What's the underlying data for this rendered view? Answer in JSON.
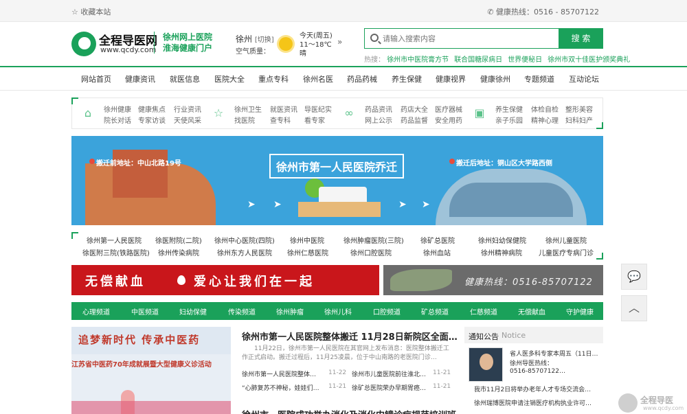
{
  "topbar": {
    "favorite": "收藏本站",
    "hotline": "健康热线：0516 - 85707122"
  },
  "logo": {
    "name": "全程导医网",
    "url": "www.qcdy.com"
  },
  "slogan": {
    "line1": "徐州网上医院",
    "line2": "淮海健康门户"
  },
  "weather": {
    "city": "徐州",
    "switch": "[切换]",
    "air": "空气质量：",
    "day": "今天(周五)",
    "temp": "11～18℃",
    "cond": "晴"
  },
  "search": {
    "placeholder": "请输入搜索内容",
    "button": "搜 索"
  },
  "hot": {
    "label": "热搜：",
    "items": [
      "徐州市中医院膏方节",
      "联合国糖尿病日",
      "世界便秘日",
      "徐州市双十佳医护颁奖典礼"
    ]
  },
  "nav": [
    "网站首页",
    "健康资讯",
    "就医信息",
    "医院大全",
    "重点专科",
    "徐州名医",
    "药品药械",
    "养生保健",
    "健康视界",
    "健康徐州",
    "专题频道",
    "互动论坛"
  ],
  "quick": {
    "g1": [
      "徐州健康",
      "健康焦点",
      "行业资讯",
      "院长对话",
      "专家访谈",
      "天使风采"
    ],
    "g2": [
      "徐州卫生",
      "就医资讯",
      "导医纪实",
      "找医院",
      "查专科",
      "看专家"
    ],
    "g3": [
      "药品资讯",
      "药店大全",
      "医疗器械",
      "网上公示",
      "药品监督",
      "安全用药"
    ],
    "g4": [
      "养生保健",
      "体检自检",
      "整形美容",
      "亲子乐园",
      "精神心理",
      "妇科妇产"
    ]
  },
  "banner": {
    "title": "徐州市第一人民医院乔迁",
    "old": "搬迁前地址：中山北路19号",
    "new": "搬迁后地址：铜山区大学路西侧"
  },
  "hospitals": {
    "row1": [
      "徐州第一人民医院",
      "徐医附院(二院)",
      "徐州中心医院(四院)",
      "徐州中医院",
      "徐州肿瘤医院(三院)",
      "徐矿总医院",
      "徐州妇幼保健院",
      "徐州儿童医院"
    ],
    "row2": [
      "徐医附三院(铁路医院)",
      "徐州传染病院",
      "徐州东方人民医院",
      "徐州仁慈医院",
      "徐州口腔医院",
      "徐州血站",
      "徐州精神病院",
      "儿童医疗专病门诊"
    ]
  },
  "ads": {
    "red1": "无偿献血",
    "red2": "爱心让我们在一起",
    "hotline": "健康热线：0516-85707122"
  },
  "channels": [
    "心理频道",
    "中医频道",
    "妇幼保健",
    "传染频道",
    "徐州肿瘤",
    "徐州儿科",
    "口腔频道",
    "矿总频道",
    "仁慈频道",
    "无偿献血",
    "守护健康"
  ],
  "photo": {
    "line1": "追梦新时代  传承中医药",
    "line2": "江苏省中医药70年成就展暨大型健康义诊活动"
  },
  "news": {
    "headline": "徐州市第一人民医院整体搬迁 11月28日新院区全面…",
    "summary": "11月22日，徐州市第一人民医院在其官网上发布消息：医院整体搬迁工作正式启动。搬迁过程后，11月25凌晨，位于中山南路的老医院门诊…",
    "items": [
      {
        "t": "徐州市第一人民医院整体…",
        "d": "11-22"
      },
      {
        "t": "徐州市儿童医院前往淮北…",
        "d": "11-21"
      },
      {
        "t": "“心肺复苏不神秘，娃娃们…",
        "d": "11-21"
      },
      {
        "t": "徐矿总医院荣办早期胃癌…",
        "d": "11-21"
      }
    ],
    "headline2": "徐州市一医院成功举办消化及消化内镜诊疗规范培训班"
  },
  "notice": {
    "title": "通知公告",
    "en": "Notice",
    "featured": [
      "省人医多科专家本周五（11日…",
      "徐州导医热线：",
      "0516-85707122…"
    ],
    "items": [
      "我市11月2日将举办老年人才专场交流会…",
      "徐州瑞博医院申请注销医疗机构执业许可…"
    ]
  },
  "side": {
    "wechat": "wechat-icon",
    "top": "up-arrow-icon"
  },
  "watermark": {
    "name": "全程导医",
    "url": "www.qcdy.com"
  }
}
